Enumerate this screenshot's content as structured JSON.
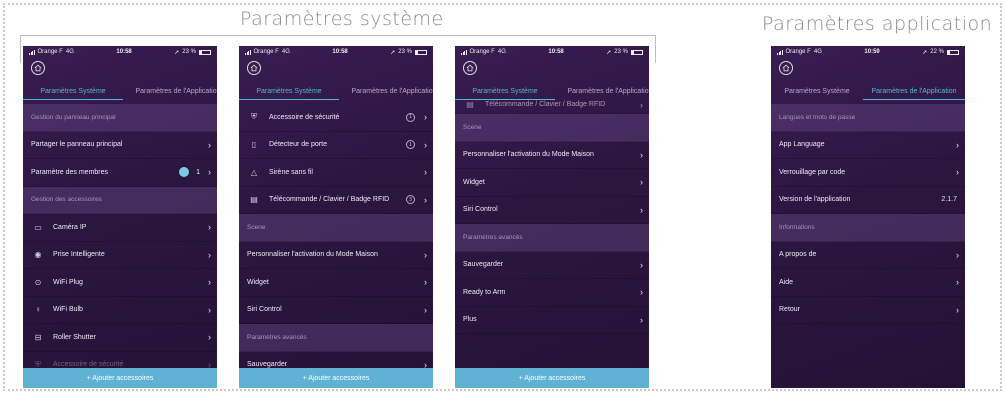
{
  "group_titles": {
    "system": "Paramètres système",
    "app": "Paramètres application"
  },
  "status_bars": [
    {
      "carrier": "Orange F",
      "network": "4G",
      "time": "10:58",
      "battery": "23 %"
    },
    {
      "carrier": "Orange F",
      "network": "4G",
      "time": "10:58",
      "battery": "23 %"
    },
    {
      "carrier": "Orange F",
      "network": "4G",
      "time": "10:58",
      "battery": "23 %"
    },
    {
      "carrier": "Orange F",
      "network": "4G",
      "time": "10:59",
      "battery": "22 %"
    }
  ],
  "tabs": {
    "system": "Paramètres Système",
    "app": "Paramètres de l'Application"
  },
  "bottom_button": "+ Ajouter accessoires",
  "phone1": {
    "rows": [
      {
        "type": "section",
        "label": "Gestion du panneau principal"
      },
      {
        "type": "item",
        "label": "Partager le panneau principal"
      },
      {
        "type": "item",
        "label": "Paramètre des membres",
        "count": "1"
      },
      {
        "type": "section",
        "label": "Gestion des accessoires"
      },
      {
        "type": "item",
        "icon": "camera-icon",
        "label": "Caméra IP"
      },
      {
        "type": "item",
        "icon": "plug-icon",
        "label": "Prise Intelligente"
      },
      {
        "type": "item",
        "icon": "wifi-plug-icon",
        "label": "WiFi Plug"
      },
      {
        "type": "item",
        "icon": "bulb-icon",
        "label": "WiFi Bulb"
      },
      {
        "type": "item",
        "icon": "shutter-icon",
        "label": "Roller Shutter"
      },
      {
        "type": "item",
        "icon": "shield-icon",
        "label": "Accessoire de sécurité"
      }
    ]
  },
  "phone2": {
    "rows": [
      {
        "type": "item",
        "label": "Accessoire de sécurité",
        "badge": "1"
      },
      {
        "type": "item",
        "label": "Détecteur de porte",
        "badge": "1"
      },
      {
        "type": "item",
        "label": "Sirène sans fil"
      },
      {
        "type": "item",
        "label": "Télécommande / Clavier / Badge RFID",
        "badge": "3"
      },
      {
        "type": "section",
        "label": "Scene"
      },
      {
        "type": "item",
        "label": "Personnaliser l'activation du Mode Maison"
      },
      {
        "type": "item",
        "label": "Widget"
      },
      {
        "type": "item",
        "label": "Siri Control"
      },
      {
        "type": "section",
        "label": "Paramètres avancés"
      },
      {
        "type": "item",
        "label": "Sauvegarder"
      }
    ]
  },
  "phone3": {
    "rows": [
      {
        "type": "item",
        "label": "Télécommande / Clavier / Badge RFID"
      },
      {
        "type": "section",
        "label": "Scene"
      },
      {
        "type": "item",
        "label": "Personnaliser l'activation du Mode Maison"
      },
      {
        "type": "item",
        "label": "Widget"
      },
      {
        "type": "item",
        "label": "Siri Control"
      },
      {
        "type": "section",
        "label": "Paramètres avancés"
      },
      {
        "type": "item",
        "label": "Sauvegarder"
      },
      {
        "type": "item",
        "label": "Ready to Arm"
      },
      {
        "type": "item",
        "label": "Plus"
      }
    ]
  },
  "phone4": {
    "rows": [
      {
        "type": "section",
        "label": "Langues et mots de passe"
      },
      {
        "type": "item",
        "label": "App Language"
      },
      {
        "type": "item",
        "label": "Verrouillage par code"
      },
      {
        "type": "item",
        "label": "Version de l'application",
        "value": "2.1.7"
      },
      {
        "type": "section",
        "label": "Informations"
      },
      {
        "type": "item",
        "label": "A propos de"
      },
      {
        "type": "item",
        "label": "Aide"
      },
      {
        "type": "item",
        "label": "Retour"
      }
    ]
  },
  "colors": {
    "accent": "#4fb9d8",
    "bottom_bar": "#5fb2d3",
    "background": "#2b1640"
  }
}
